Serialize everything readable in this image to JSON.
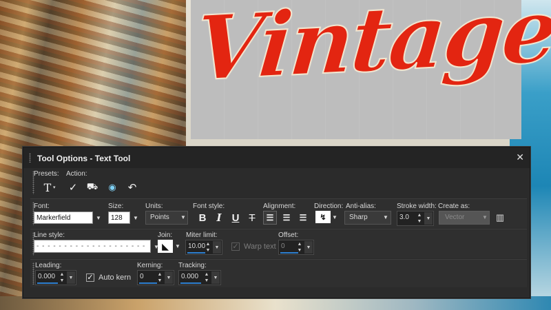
{
  "canvas": {
    "text": "Vintage"
  },
  "panel": {
    "title": "Tool Options - Text Tool",
    "close_icon": "✕",
    "presets_label": "Presets:",
    "action_label": "Action:",
    "presets_icon": "T",
    "actions": [
      {
        "name": "apply",
        "glyph": "✓"
      },
      {
        "name": "convert-to-path",
        "glyph": "⛟"
      },
      {
        "name": "eye",
        "glyph": "◉"
      },
      {
        "name": "undo",
        "glyph": "↶"
      }
    ],
    "font": {
      "label": "Font:",
      "value": "Markerfield"
    },
    "size": {
      "label": "Size:",
      "value": "128"
    },
    "units": {
      "label": "Units:",
      "value": "Points"
    },
    "font_style": {
      "label": "Font style:",
      "bold": "B",
      "italic": "I",
      "underline": "U",
      "strike": "T"
    },
    "alignment": {
      "label": "Alignment:"
    },
    "direction": {
      "label": "Direction:"
    },
    "anti_alias": {
      "label": "Anti-alias:",
      "value": "Sharp"
    },
    "stroke_width": {
      "label": "Stroke width:",
      "value": "3.0"
    },
    "create_as": {
      "label": "Create as:",
      "value": "Vector"
    },
    "line_style": {
      "label": "Line style:"
    },
    "join": {
      "label": "Join:"
    },
    "miter_limit": {
      "label": "Miter limit:",
      "value": "10.00"
    },
    "warp_text": {
      "label": "Warp text"
    },
    "offset": {
      "label": "Offset:",
      "value": "0"
    },
    "leading": {
      "label": "Leading:",
      "value": "0.000"
    },
    "auto_kern": {
      "label": "Auto kern",
      "checked": "✓"
    },
    "kerning": {
      "label": "Kerning:",
      "value": "0"
    },
    "tracking": {
      "label": "Tracking:",
      "value": "0.000"
    }
  }
}
